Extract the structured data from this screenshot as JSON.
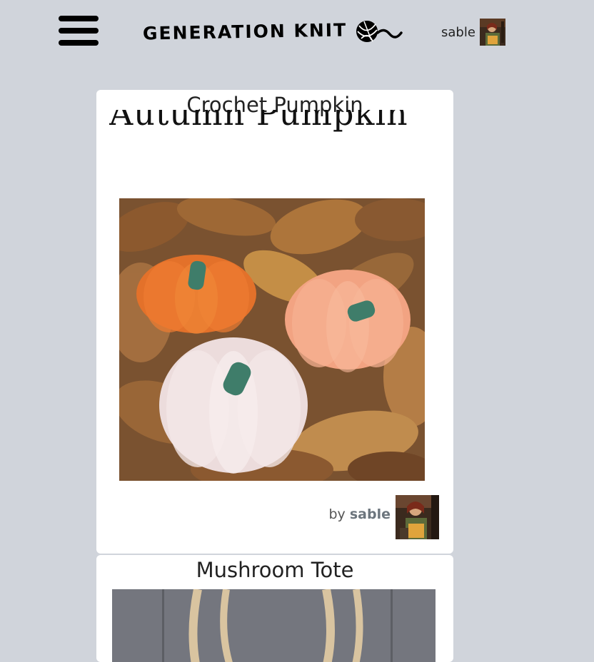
{
  "header": {
    "logo_text": "GENERATION KNIT",
    "user_name": "sable"
  },
  "posts": [
    {
      "title": "Crochet Pumpkin",
      "image_heading": "Autumn Pumpkin",
      "by_prefix": "by",
      "author": "sable"
    },
    {
      "title": "Mushroom Tote"
    }
  ],
  "colors": {
    "background": "#d0d4db",
    "card": "#ffffff",
    "pumpkin_orange": "#e8742a",
    "pumpkin_peach": "#f3a98a",
    "pumpkin_cream": "#f1e4e4",
    "stem_green": "#3f7d6a"
  },
  "icons": [
    "hamburger-menu-icon",
    "yarn-ball-icon"
  ]
}
